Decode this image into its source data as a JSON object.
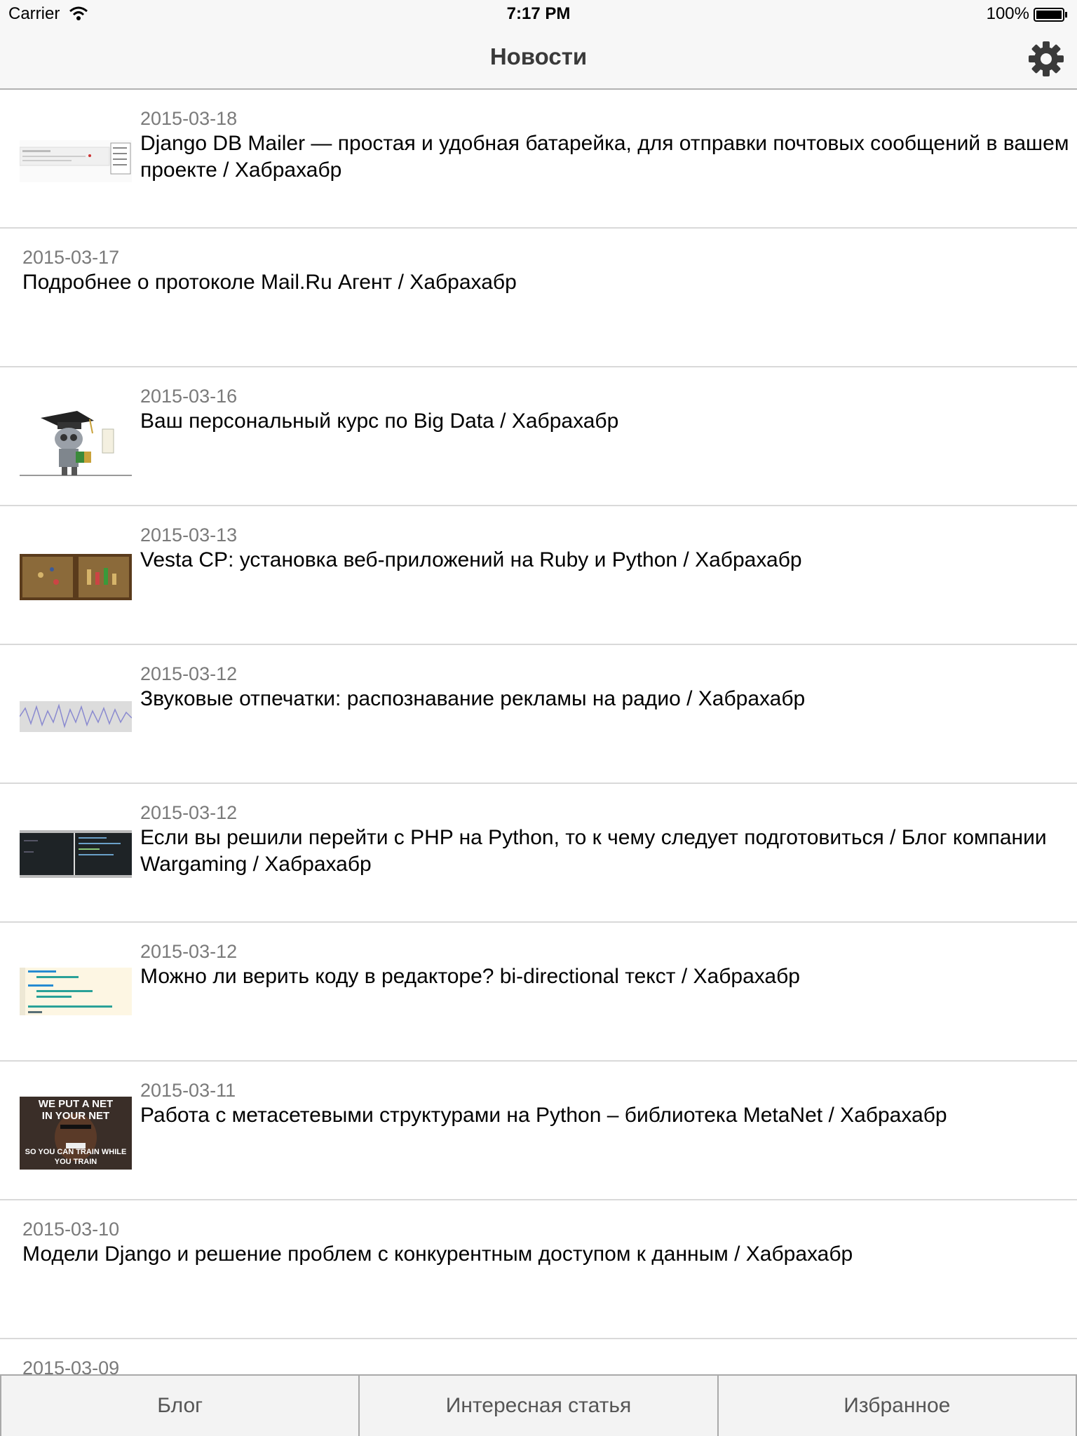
{
  "status_bar": {
    "carrier": "Carrier",
    "time": "7:17 PM",
    "battery": "100%"
  },
  "nav": {
    "title": "Новости",
    "settings_icon": "gear-icon"
  },
  "news": [
    {
      "date": "2015-03-18",
      "title": "Django DB Mailer — простая и удобная батарейка, для отправки почтовых сообщений в вашем проекте / Хабрахабр",
      "thumbnail": "screenshot-thumb"
    },
    {
      "date": "2015-03-17",
      "title": "Подробнее о протоколе Mail.Ru Агент / Хабрахабр",
      "thumbnail": ""
    },
    {
      "date": "2015-03-16",
      "title": "Ваш персональный курс по Big Data / Хабрахабр",
      "thumbnail": "robot-graduate-thumb"
    },
    {
      "date": "2015-03-13",
      "title": "Vesta CP: установка веб-приложений на Ruby и Python / Хабрахабр",
      "thumbnail": "game-board-thumb"
    },
    {
      "date": "2015-03-12",
      "title": "Звуковые отпечатки: распознавание рекламы на радио / Хабрахабр",
      "thumbnail": "waveform-thumb"
    },
    {
      "date": "2015-03-12",
      "title": "Если вы решили перейти с PHP на Python, то к чему следует подготовиться / Блог компании Wargaming / Хабрахабр",
      "thumbnail": "terminal-thumb"
    },
    {
      "date": "2015-03-12",
      "title": "Можно ли верить коду в редакторе? bi-directional текст / Хабрахабр",
      "thumbnail": "code-thumb"
    },
    {
      "date": "2015-03-11",
      "title": "Работа с метасетевыми структурами на Python – библиотека MetaNet / Хабрахабр",
      "thumbnail": "meme-thumb",
      "meme_top": "WE PUT A NET IN YOUR NET",
      "meme_bottom": "SO YOU CAN TRAIN WHILE YOU TRAIN"
    },
    {
      "date": "2015-03-10",
      "title": "Модели Django и решение проблем с конкурентным доступом к данным / Хабрахабр",
      "thumbnail": ""
    },
    {
      "date": "2015-03-09",
      "title": "",
      "thumbnail": ""
    }
  ],
  "tabs": [
    {
      "label": "Блог"
    },
    {
      "label": "Интересная статья"
    },
    {
      "label": "Избранное"
    }
  ]
}
